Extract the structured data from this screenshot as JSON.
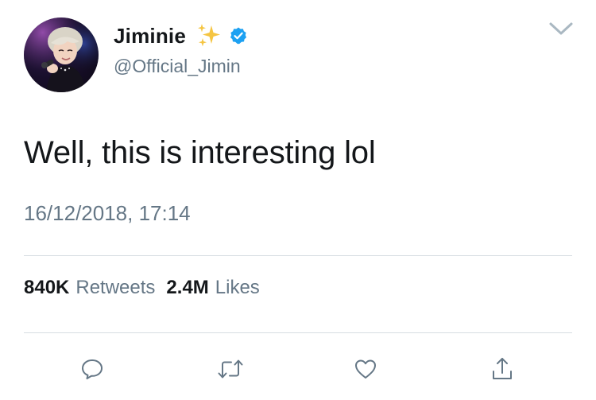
{
  "tweet": {
    "display_name": "Jiminie",
    "handle": "@Official_Jimin",
    "text": "Well, this is interesting lol",
    "timestamp": "16/12/2018, 17:14",
    "verified": true
  },
  "stats": {
    "retweets_count": "840K",
    "retweets_label": "Retweets",
    "likes_count": "2.4M",
    "likes_label": "Likes"
  },
  "colors": {
    "text_primary": "#14171a",
    "text_secondary": "#657786",
    "verified_blue": "#1da1f2",
    "divider": "#d7dde2",
    "sparkle_gold": "#f5c542"
  },
  "icons": {
    "avatar": "profile-photo",
    "sparkles": "sparkles-emoji",
    "verified": "verified-badge-icon",
    "menu": "chevron-down-icon",
    "reply": "reply-icon",
    "retweet": "retweet-icon",
    "like": "heart-icon",
    "share": "share-icon"
  }
}
